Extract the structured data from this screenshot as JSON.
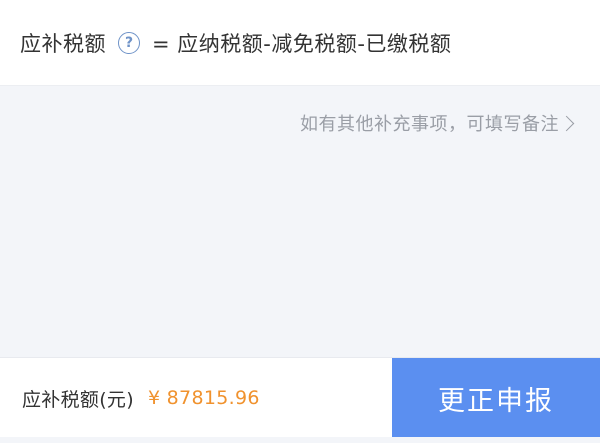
{
  "formula": {
    "label": "应补税额",
    "help_icon": "question-circle-icon",
    "help_glyph": "?",
    "expression": "= 应纳税额-减免税额-已缴税额"
  },
  "remark": {
    "link_text": "如有其他补充事项，可填写备注",
    "icon": "chevron-right-icon"
  },
  "bottom_bar": {
    "label": "应补税额(元)",
    "amount": "¥ 87815.96",
    "submit_label": "更正申报"
  },
  "colors": {
    "accent": "#5b8ff0",
    "amount": "#f0922e",
    "help_icon": "#6f93c8",
    "muted_text": "#9a9ea6"
  }
}
